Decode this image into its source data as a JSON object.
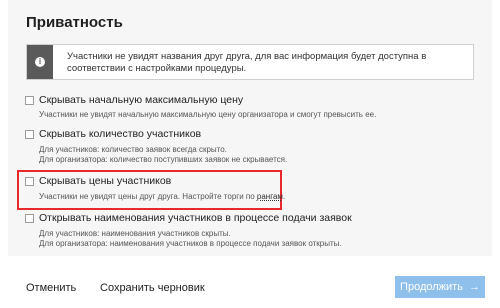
{
  "section": {
    "title": "Приватность"
  },
  "info": {
    "text": "Участники не увидят названия друг друга, для вас информация будет доступна в соответствии с настройками процедуры."
  },
  "options": [
    {
      "label": "Скрывать начальную максимальную цену",
      "desc1": "Участники не увидят начальную максимальную цену организатора и смогут превысить ее.",
      "desc2": ""
    },
    {
      "label": "Скрывать количество участников",
      "desc1": "Для участников: количество заявок всегда скрыто.",
      "desc2": "Для организатора: количество поступивших заявок не скрывается."
    },
    {
      "label": "Скрывать цены участников",
      "desc_prefix": "Участники не увидят цены друг друга. Настройте торги по ",
      "desc_link": "рангам",
      "desc_suffix": "."
    },
    {
      "label": "Открывать наименования участников в процессе подачи заявок",
      "desc1": "Для участников: наименования участников скрыты.",
      "desc2": "Для организатора: наименования участников в процессе подачи заявок открыты."
    }
  ],
  "footer": {
    "cancel": "Отменить",
    "save_draft": "Сохранить черновик",
    "continue": "Продолжить",
    "continue_arrow": "→"
  },
  "colors": {
    "highlight": "#e8292c",
    "primary": "#8fc0ec",
    "info_bar": "#5a5a5a"
  }
}
